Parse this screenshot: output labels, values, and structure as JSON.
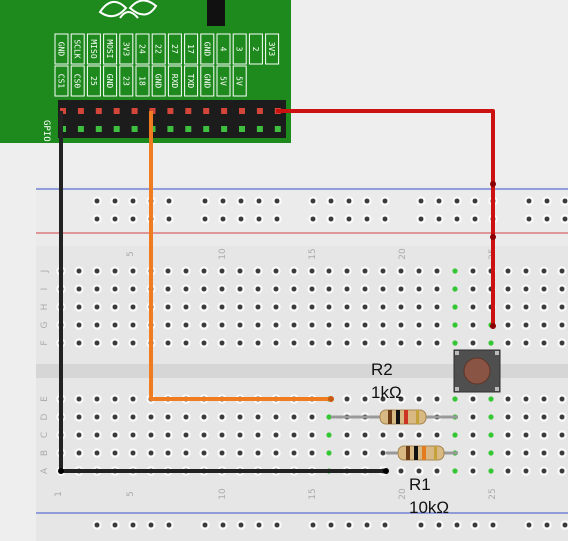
{
  "pi": {
    "gpio_label": "GPIO",
    "header_top": [
      "GND",
      "SCLK",
      "MISO",
      "MOSI",
      "3V3",
      "24",
      "22",
      "27",
      "17",
      "GND",
      "4",
      "3",
      "2",
      "3V3"
    ],
    "header_bottom": [
      "CS1",
      "CS0",
      "25",
      "GND",
      "23",
      "18",
      "GND",
      "RXD",
      "TXD",
      "GND",
      "5V",
      "5V"
    ],
    "board_color": "#1e8a1e",
    "pin_colors": {
      "odd": "#d4453a",
      "even": "#3fbf3f"
    }
  },
  "breadboard": {
    "row_letters_top": [
      "J",
      "I",
      "H",
      "G",
      "F"
    ],
    "row_letters_bottom": [
      "E",
      "D",
      "C",
      "B",
      "A"
    ],
    "column_numbers_top": [
      "5",
      "10",
      "15",
      "20",
      "25"
    ],
    "column_numbers_bottom": [
      "1",
      "5",
      "10",
      "15",
      "20",
      "25"
    ],
    "rail_colors": {
      "positive": "#cc3333",
      "negative": "#3333aa"
    }
  },
  "components": {
    "r2": {
      "name": "R2",
      "value": "1kΩ"
    },
    "r1": {
      "name": "R1",
      "value": "10kΩ"
    },
    "button": {
      "type": "push-button"
    }
  },
  "wires": {
    "red": "#cc1111",
    "black": "#222222",
    "orange": "#f07c22",
    "gray": "#999999"
  }
}
